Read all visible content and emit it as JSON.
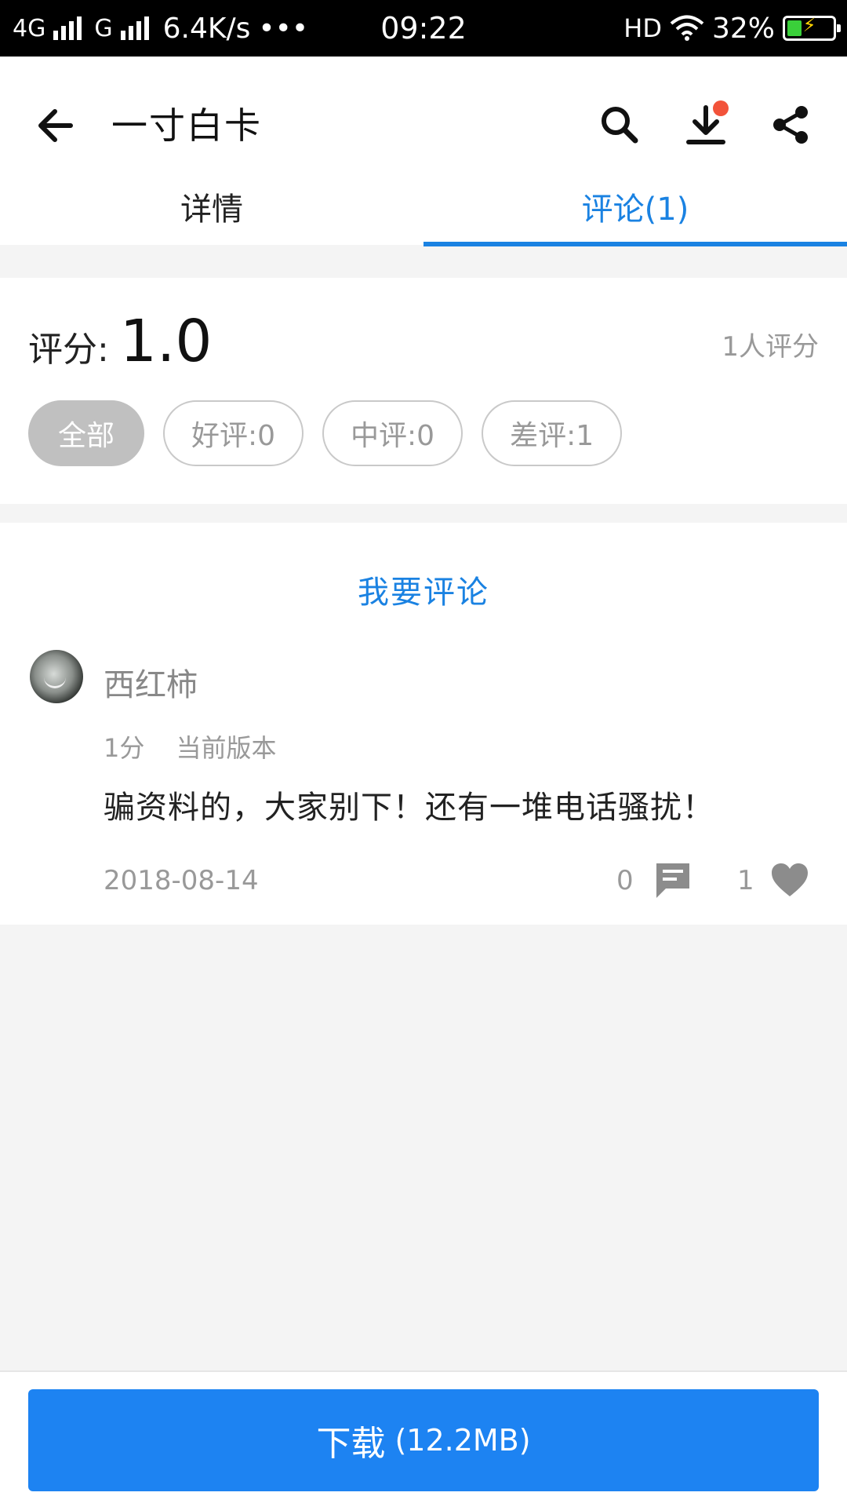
{
  "status_bar": {
    "network_left": "4G",
    "network_right": "G",
    "speed": "6.4K/s",
    "dots": "•••",
    "time": "09:22",
    "hd": "HD",
    "battery_percent": "32%",
    "battery_level": 0.32
  },
  "header": {
    "title": "一寸白卡",
    "tabs": [
      {
        "label": "详情",
        "active": false
      },
      {
        "label": "评论(1)",
        "active": true
      }
    ]
  },
  "rating": {
    "label": "评分:",
    "value": "1.0",
    "raters": "1人评分",
    "filters": [
      {
        "label": "全部",
        "selected": true
      },
      {
        "label": "好评:0",
        "selected": false
      },
      {
        "label": "中评:0",
        "selected": false
      },
      {
        "label": "差评:1",
        "selected": false
      }
    ]
  },
  "comments": {
    "write_label": "我要评论",
    "items": [
      {
        "username": "西红柿",
        "score": "1分",
        "version": "当前版本",
        "text": "骗资料的，大家别下！还有一堆电话骚扰！",
        "date": "2018-08-14",
        "replies": "0",
        "likes": "1"
      }
    ]
  },
  "bottom": {
    "download_label": "下载",
    "download_size": "(12.2MB)"
  },
  "colors": {
    "accent": "#1a82e2",
    "download_button": "#1d83f2",
    "notify_dot": "#f2533a"
  },
  "icons": [
    "back-arrow-icon",
    "search-icon",
    "download-icon",
    "share-icon",
    "comment-bubble-icon",
    "heart-icon",
    "wifi-icon",
    "battery-icon"
  ]
}
